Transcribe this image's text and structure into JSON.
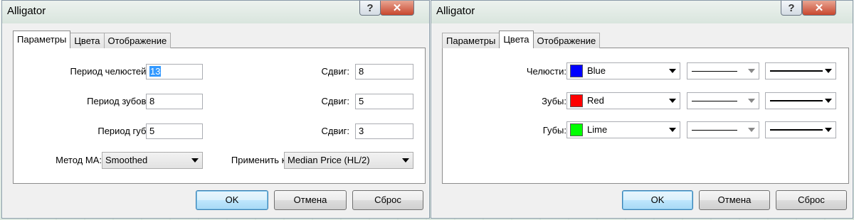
{
  "dialogs": [
    {
      "title": "Alligator",
      "tabs": [
        "Параметры",
        "Цвета",
        "Отображение"
      ],
      "active_tab": "Параметры",
      "params": {
        "jaw_period": {
          "label": "Период челюстей:",
          "value": "13"
        },
        "teeth_period": {
          "label": "Период зубов:",
          "value": "8"
        },
        "lips_period": {
          "label": "Период губ:",
          "value": "5"
        },
        "jaw_shift": {
          "label": "Сдвиг:",
          "value": "8"
        },
        "teeth_shift": {
          "label": "Сдвиг:",
          "value": "5"
        },
        "lips_shift": {
          "label": "Сдвиг:",
          "value": "3"
        },
        "ma_method": {
          "label": "Метод МА:",
          "value": "Smoothed"
        },
        "apply_to": {
          "label": "Применить к:",
          "value": "Median Price (HL/2)"
        }
      },
      "buttons": {
        "ok": "OK",
        "cancel": "Отмена",
        "reset": "Сброс"
      }
    },
    {
      "title": "Alligator",
      "tabs": [
        "Параметры",
        "Цвета",
        "Отображение"
      ],
      "active_tab": "Цвета",
      "colors": [
        {
          "label": "Челюсти:",
          "color_name": "Blue",
          "swatch": "#0000ff"
        },
        {
          "label": "Зубы:",
          "color_name": "Red",
          "swatch": "#ff0000"
        },
        {
          "label": "Губы:",
          "color_name": "Lime",
          "swatch": "#00ff00"
        }
      ],
      "buttons": {
        "ok": "OK",
        "cancel": "Отмена",
        "reset": "Сброс"
      }
    }
  ],
  "icons": {
    "help": "help-icon",
    "close": "close-icon"
  }
}
